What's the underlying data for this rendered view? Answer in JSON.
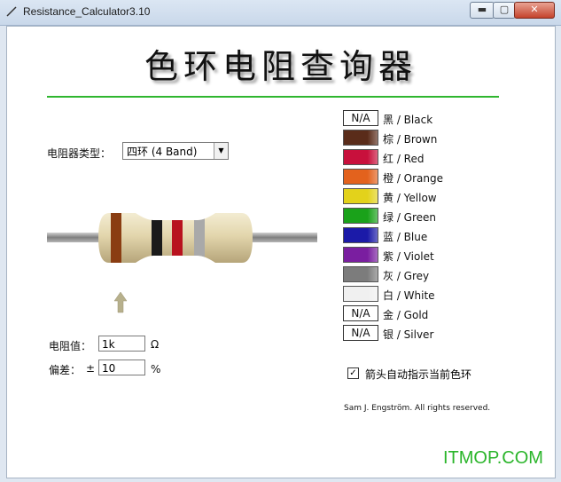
{
  "window": {
    "title": "Resistance_Calculator3.10",
    "min": "▬",
    "max": "▢",
    "close": "✕"
  },
  "header": {
    "title": "色环电阻查询器"
  },
  "type_selector": {
    "label": "电阻器类型：",
    "value": "四环 (4 Band)"
  },
  "resistance": {
    "label": "电阻值：",
    "value": "1k",
    "unit": "Ω"
  },
  "tolerance": {
    "label": "偏差：",
    "sign": "±",
    "value": "10",
    "unit": "%"
  },
  "colors": [
    {
      "name": "黑 / Black",
      "swatch_text": "N/A",
      "color": "#ffffff"
    },
    {
      "name": "棕 / Brown",
      "swatch_text": "",
      "color": "#5a2c1a"
    },
    {
      "name": "红 / Red",
      "swatch_text": "",
      "color": "#c8103c"
    },
    {
      "name": "橙 / Orange",
      "swatch_text": "",
      "color": "#e3621d"
    },
    {
      "name": "黄 / Yellow",
      "swatch_text": "",
      "color": "#e3d21b"
    },
    {
      "name": "绿 / Green",
      "swatch_text": "",
      "color": "#1aa21a"
    },
    {
      "name": "蓝 / Blue",
      "swatch_text": "",
      "color": "#1b1aa8"
    },
    {
      "name": "紫 / Violet",
      "swatch_text": "",
      "color": "#7a1ea0"
    },
    {
      "name": "灰 / Grey",
      "swatch_text": "",
      "color": "#7c7c7c"
    },
    {
      "name": "白 / White",
      "swatch_text": "",
      "color": "#f0f0f0"
    },
    {
      "name": "金 / Gold",
      "swatch_text": "N/A",
      "color": "#ffffff"
    },
    {
      "name": "银 / Silver",
      "swatch_text": "N/A",
      "color": "#ffffff"
    }
  ],
  "auto_indicator": {
    "label": "箭头自动指示当前色环",
    "checked": "✓"
  },
  "footer": {
    "copyright": "Sam J. Engström. All rights reserved."
  },
  "watermark": "ITMOP.COM",
  "resistor_bands": [
    "#8a3d12",
    "#1a1a1a",
    "#b8121e",
    "#a9a9a9"
  ]
}
